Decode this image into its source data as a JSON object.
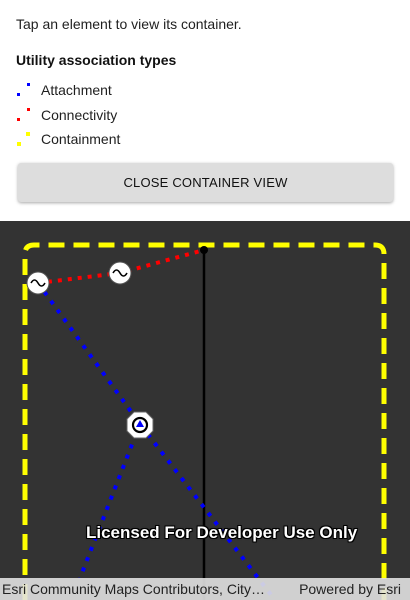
{
  "instruction": "Tap an element to view its container.",
  "legend": {
    "title": "Utility association types",
    "items": [
      {
        "label": "Attachment",
        "color": "#0000ff",
        "icon": "attachment-dots-icon"
      },
      {
        "label": "Connectivity",
        "color": "#ff0000",
        "icon": "connectivity-dots-icon"
      },
      {
        "label": "Containment",
        "color": "#ffff00",
        "icon": "containment-dots-icon"
      }
    ]
  },
  "close_button": {
    "label": "CLOSE CONTAINER VIEW"
  },
  "map": {
    "background_color": "#333333",
    "container_boundary_color": "#ffff00",
    "watermark": "Licensed For Developer Use Only",
    "attribution": {
      "left": "Esri Community Maps Contributors, City…",
      "right": "Powered by Esri"
    }
  }
}
